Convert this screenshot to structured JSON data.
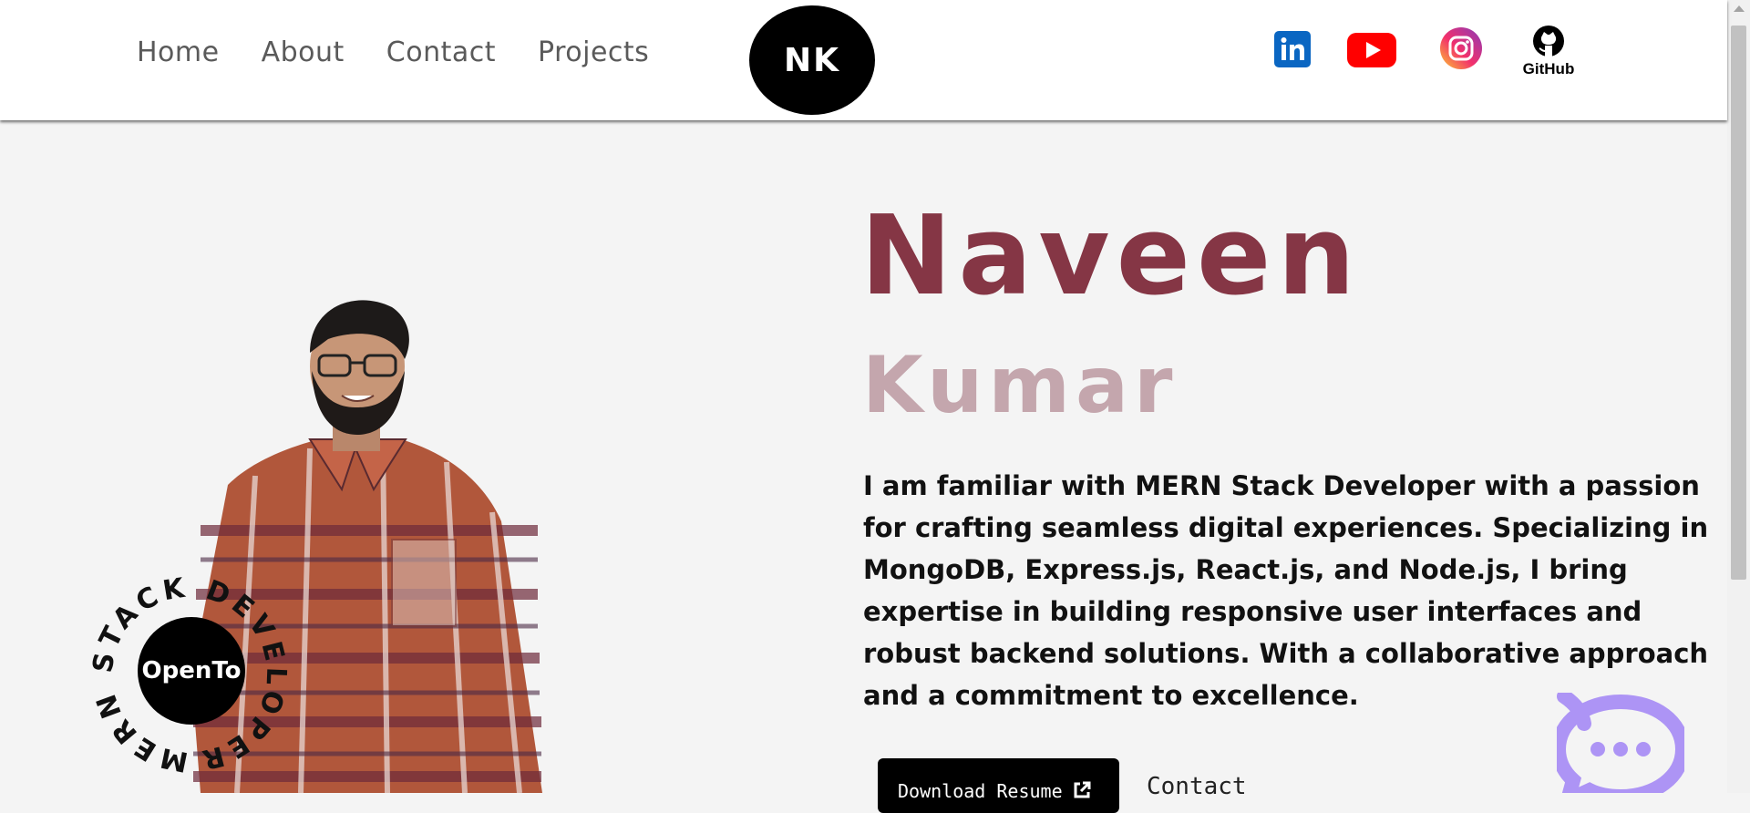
{
  "nav": {
    "links": [
      "Home",
      "About",
      "Contact",
      "Projects"
    ],
    "logo_text": "NK"
  },
  "socials": [
    {
      "icon": "linkedin-icon",
      "color": "#0a66c2"
    },
    {
      "icon": "youtube-icon",
      "color": "#ff0000"
    },
    {
      "icon": "instagram-icon",
      "color": "#e1306c"
    },
    {
      "icon": "github-icon",
      "label": "GitHub",
      "color": "#000000"
    }
  ],
  "hero": {
    "first_name": "Naveen",
    "last_name": "Kumar",
    "bio": "I am familiar with MERN Stack Developer with a passion for crafting seamless digital experiences. Specializing in MongoDB, Express.js, React.js, and Node.js, I bring expertise in building responsive user interfaces and robust backend solutions. With a collaborative approach and a commitment to excellence.",
    "resume_button": "Download Resume",
    "contact_button": "Contact"
  },
  "badge": {
    "center": "OpenTo",
    "ring_text": "MERN STACK DEVELOPER"
  },
  "colors": {
    "first_name": "#853645",
    "last_name": "#c4a6ad",
    "chat_bubble": "#ad94f5"
  }
}
